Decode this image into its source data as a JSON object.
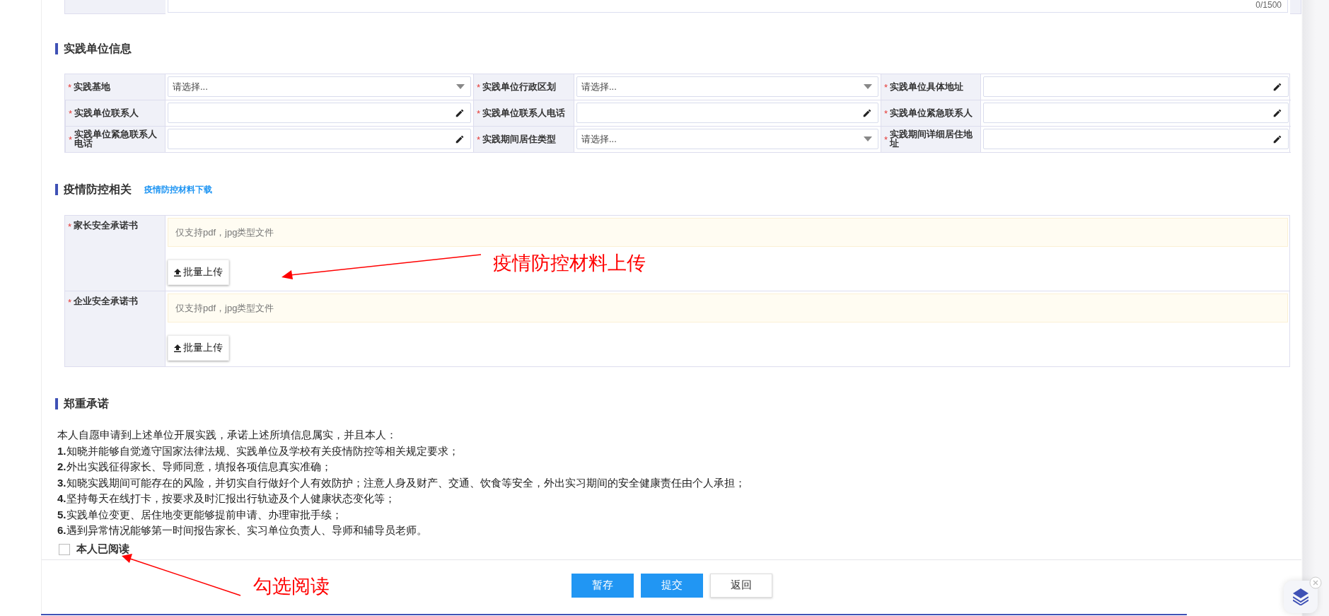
{
  "top_field": {
    "counter": "0/1500"
  },
  "unit_info": {
    "title": "实践单位信息",
    "fields": [
      {
        "mark": "*",
        "label": "实践基地",
        "kind": "select",
        "placeholder": "请选择..."
      },
      {
        "mark": "*",
        "label": "实践单位行政区划",
        "kind": "select",
        "placeholder": "请选择..."
      },
      {
        "mark": "*",
        "label": "实践单位具体地址",
        "kind": "text"
      },
      {
        "mark": "*",
        "label": "实践单位联系人",
        "kind": "text"
      },
      {
        "mark": "*",
        "label": "实践单位联系人电话",
        "kind": "text"
      },
      {
        "mark": "*",
        "label": "实践单位紧急联系人",
        "kind": "text"
      },
      {
        "mark": "*",
        "label": "实践单位紧急联系人电话",
        "kind": "text"
      },
      {
        "mark": "*",
        "label": "实践期间居住类型",
        "kind": "select",
        "placeholder": "请选择..."
      },
      {
        "mark": "*",
        "label": "实践期间详细居住地址",
        "kind": "text"
      }
    ]
  },
  "epidemic": {
    "title": "疫情防控相关",
    "link": "疫情防控材料下载",
    "uploads": [
      {
        "mark": "*",
        "label": "家长安全承诺书",
        "hint": "仅支持pdf，jpg类型文件",
        "button": "批量上传"
      },
      {
        "mark": "*",
        "label": "企业安全承诺书",
        "hint": "仅支持pdf，jpg类型文件",
        "button": "批量上传"
      }
    ]
  },
  "pledge": {
    "title": "郑重承诺",
    "lines": [
      "本人自愿申请到上述单位开展实践，承诺上述所填信息属实，并且本人：",
      "**1.**知晓并能够自觉遵守国家法律法规、实践单位及学校有关疫情防控等相关规定要求；",
      "**2.**外出实践征得家长、导师同意，填报各项信息真实准确；",
      "**3.**知晓实践期间可能存在的风险，并切实自行做好个人有效防护；注意人身及财产、交通、饮食等安全，外出实习期间的安全健康责任由个人承担；",
      "**4.**坚持每天在线打卡，按要求及时汇报出行轨迹及个人健康状态变化等；",
      "**5.**实践单位变更、居住地变更能够提前申请、办理审批手续；",
      "**6.**遇到异常情况能够第一时间报告家长、实习单位负责人、导师和辅导员老师。"
    ],
    "checkbox": {
      "label": "本人已阅读",
      "checked": false
    }
  },
  "buttons": [
    {
      "label": "暂存",
      "kind": "primary"
    },
    {
      "label": "提交",
      "kind": "primary"
    },
    {
      "label": "返回",
      "kind": "default"
    }
  ],
  "annotations": [
    {
      "text": "疫情防控材料上传"
    },
    {
      "text": "勾选阅读"
    }
  ]
}
